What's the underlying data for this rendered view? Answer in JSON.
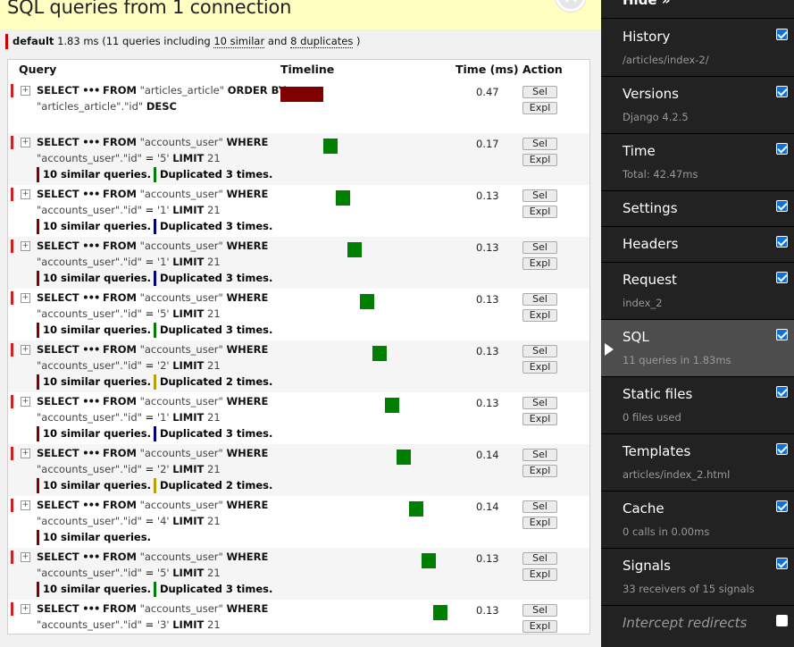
{
  "header": {
    "title": "SQL queries from 1 connection"
  },
  "db_summary": {
    "alias": "default",
    "time": "1.83 ms",
    "pre": "(11 queries including",
    "similar": "10 similar",
    "and": "and",
    "duplicates": "8 duplicates",
    "post": ")"
  },
  "table": {
    "col_query": "Query",
    "col_timeline": "Timeline",
    "col_time": "Time (ms)",
    "col_action": "Action",
    "sel_label": "Sel",
    "expl_label": "Expl",
    "toggle_label": "+",
    "rows": [
      {
        "select": "SELECT",
        "ellipsis": "•••",
        "from": "FROM",
        "table": "\"articles_article\"",
        "clause": "ORDER BY",
        "cond_col": "\"articles_article\".\"id\"",
        "cond_op": "",
        "cond_val": "",
        "tail": "DESC",
        "tail_val": "",
        "time": "0.47",
        "similar": "",
        "duplicated": "",
        "similar_color": "#800000",
        "dup_color": "#800000",
        "timeline_start": 0.0,
        "timeline_width": 0.0
      },
      {
        "select": "SELECT",
        "ellipsis": "•••",
        "from": "FROM",
        "table": "\"accounts_user\"",
        "clause": "WHERE",
        "cond_col": "\"accounts_user\".\"id\"",
        "cond_op": "=",
        "cond_val": "'5'",
        "tail": "LIMIT",
        "tail_val": "21",
        "time": "0.17",
        "similar": "10 similar queries.",
        "duplicated": "Duplicated 3 times.",
        "similar_color": "#800000",
        "dup_color": "#008000"
      },
      {
        "select": "SELECT",
        "ellipsis": "•••",
        "from": "FROM",
        "table": "\"accounts_user\"",
        "clause": "WHERE",
        "cond_col": "\"accounts_user\".\"id\"",
        "cond_op": "=",
        "cond_val": "'1'",
        "tail": "LIMIT",
        "tail_val": "21",
        "time": "0.13",
        "similar": "10 similar queries.",
        "duplicated": "Duplicated 3 times.",
        "similar_color": "#800000",
        "dup_color": "#000080"
      },
      {
        "select": "SELECT",
        "ellipsis": "•••",
        "from": "FROM",
        "table": "\"accounts_user\"",
        "clause": "WHERE",
        "cond_col": "\"accounts_user\".\"id\"",
        "cond_op": "=",
        "cond_val": "'1'",
        "tail": "LIMIT",
        "tail_val": "21",
        "time": "0.13",
        "similar": "10 similar queries.",
        "duplicated": "Duplicated 3 times.",
        "similar_color": "#800000",
        "dup_color": "#000080"
      },
      {
        "select": "SELECT",
        "ellipsis": "•••",
        "from": "FROM",
        "table": "\"accounts_user\"",
        "clause": "WHERE",
        "cond_col": "\"accounts_user\".\"id\"",
        "cond_op": "=",
        "cond_val": "'5'",
        "tail": "LIMIT",
        "tail_val": "21",
        "time": "0.13",
        "similar": "10 similar queries.",
        "duplicated": "Duplicated 3 times.",
        "similar_color": "#800000",
        "dup_color": "#008000"
      },
      {
        "select": "SELECT",
        "ellipsis": "•••",
        "from": "FROM",
        "table": "\"accounts_user\"",
        "clause": "WHERE",
        "cond_col": "\"accounts_user\".\"id\"",
        "cond_op": "=",
        "cond_val": "'2'",
        "tail": "LIMIT",
        "tail_val": "21",
        "time": "0.13",
        "similar": "10 similar queries.",
        "duplicated": "Duplicated 2 times.",
        "similar_color": "#800000",
        "dup_color": "#b8a000"
      },
      {
        "select": "SELECT",
        "ellipsis": "•••",
        "from": "FROM",
        "table": "\"accounts_user\"",
        "clause": "WHERE",
        "cond_col": "\"accounts_user\".\"id\"",
        "cond_op": "=",
        "cond_val": "'1'",
        "tail": "LIMIT",
        "tail_val": "21",
        "time": "0.13",
        "similar": "10 similar queries.",
        "duplicated": "Duplicated 3 times.",
        "similar_color": "#800000",
        "dup_color": "#000080"
      },
      {
        "select": "SELECT",
        "ellipsis": "•••",
        "from": "FROM",
        "table": "\"accounts_user\"",
        "clause": "WHERE",
        "cond_col": "\"accounts_user\".\"id\"",
        "cond_op": "=",
        "cond_val": "'2'",
        "tail": "LIMIT",
        "tail_val": "21",
        "time": "0.14",
        "similar": "10 similar queries.",
        "duplicated": "Duplicated 2 times.",
        "similar_color": "#800000",
        "dup_color": "#b8a000"
      },
      {
        "select": "SELECT",
        "ellipsis": "•••",
        "from": "FROM",
        "table": "\"accounts_user\"",
        "clause": "WHERE",
        "cond_col": "\"accounts_user\".\"id\"",
        "cond_op": "=",
        "cond_val": "'4'",
        "tail": "LIMIT",
        "tail_val": "21",
        "time": "0.14",
        "similar": "10 similar queries.",
        "duplicated": "",
        "similar_color": "#800000",
        "dup_color": "#800000"
      },
      {
        "select": "SELECT",
        "ellipsis": "•••",
        "from": "FROM",
        "table": "\"accounts_user\"",
        "clause": "WHERE",
        "cond_col": "\"accounts_user\".\"id\"",
        "cond_op": "=",
        "cond_val": "'5'",
        "tail": "LIMIT",
        "tail_val": "21",
        "time": "0.13",
        "similar": "10 similar queries.",
        "duplicated": "Duplicated 3 times.",
        "similar_color": "#800000",
        "dup_color": "#008000"
      },
      {
        "select": "SELECT",
        "ellipsis": "•••",
        "from": "FROM",
        "table": "\"accounts_user\"",
        "clause": "WHERE",
        "cond_col": "\"accounts_user\".\"id\"",
        "cond_op": "=",
        "cond_val": "'3'",
        "tail": "LIMIT",
        "tail_val": "21",
        "time": "0.13",
        "similar": "10 similar queries.",
        "duplicated": "",
        "similar_color": "#800000",
        "dup_color": "#800000"
      }
    ]
  },
  "sidebar": {
    "hide": "Hide »",
    "panels": [
      {
        "title": "History",
        "subtitle": "/articles/index-2/",
        "checked": true,
        "active": false
      },
      {
        "title": "Versions",
        "subtitle": "Django 4.2.5",
        "checked": true,
        "active": false
      },
      {
        "title": "Time",
        "subtitle": "Total: 42.47ms",
        "checked": true,
        "active": false
      },
      {
        "title": "Settings",
        "subtitle": "",
        "checked": true,
        "active": false
      },
      {
        "title": "Headers",
        "subtitle": "",
        "checked": true,
        "active": false
      },
      {
        "title": "Request",
        "subtitle": "index_2",
        "checked": true,
        "active": false
      },
      {
        "title": "SQL",
        "subtitle": "11 queries in 1.83ms",
        "checked": true,
        "active": true
      },
      {
        "title": "Static files",
        "subtitle": "0 files used",
        "checked": true,
        "active": false
      },
      {
        "title": "Templates",
        "subtitle": "articles/index_2.html",
        "checked": true,
        "active": false
      },
      {
        "title": "Cache",
        "subtitle": "0 calls in 0.00ms",
        "checked": true,
        "active": false
      },
      {
        "title": "Signals",
        "subtitle": "33 receivers of 15 signals",
        "checked": true,
        "active": false
      }
    ],
    "intercept": "Intercept redirects",
    "intercept_checked": false
  }
}
